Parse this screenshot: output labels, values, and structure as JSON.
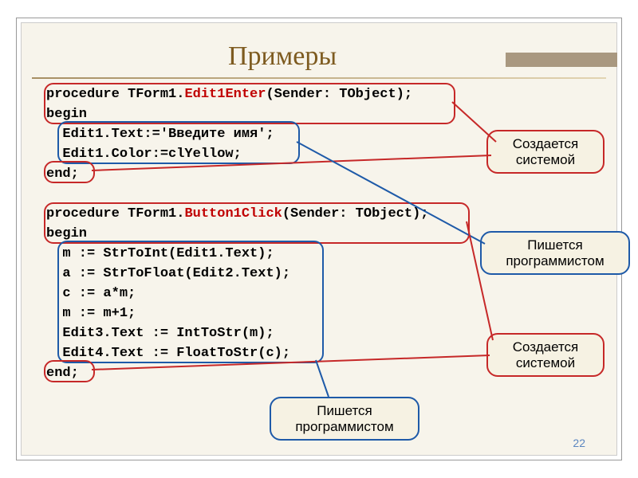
{
  "title": "Примеры",
  "page_number": "22",
  "code1": {
    "sig_pre": "procedure TForm1.",
    "sig_evt": "Edit1Enter",
    "sig_post": "(Sender: TObject);",
    "begin": "begin",
    "body_l1": "  Edit1.Text:='Введите имя';",
    "body_l2": "  Edit1.Color:=clYellow;",
    "end": "end;"
  },
  "code2": {
    "sig_pre": "procedure TForm1.",
    "sig_evt": "Button1Click",
    "sig_post": "(Sender: TObject);",
    "begin": "begin",
    "body_l1": "  m := StrToInt(Edit1.Text);",
    "body_l2": "  a := StrToFloat(Edit2.Text);",
    "body_l3": "  c := a*m;",
    "body_l4": "  m := m+1;",
    "body_l5": "  Edit3.Text := IntToStr(m);",
    "body_l6": "  Edit4.Text := FloatToStr(c);",
    "end": "end;"
  },
  "captions": {
    "system_created": "Создается системой",
    "written_by_programmer": "Пишется программистом"
  }
}
